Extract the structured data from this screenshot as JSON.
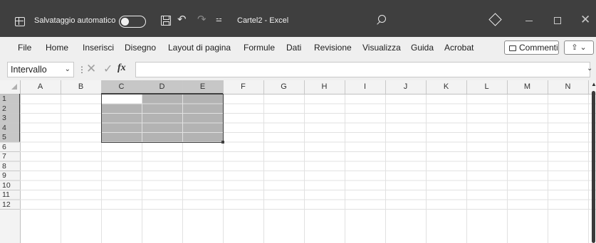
{
  "titlebar": {
    "autosave_label": "Salvataggio automatico",
    "filename": "Cartel2 - Excel",
    "undo_glyph": "↶",
    "redo_glyph": "↷",
    "qat_glyph": "⚍",
    "close_glyph": "✕",
    "icons": [
      "excel-icon",
      "autosave-toggle",
      "save-icon",
      "undo-icon",
      "redo-icon",
      "qat-customize-icon",
      "search-icon",
      "diamond-icon",
      "minimize-icon",
      "maximize-icon",
      "close-icon"
    ]
  },
  "menu": {
    "items": [
      "File",
      "Home",
      "Inserisci",
      "Disegno",
      "Layout di pagina",
      "Formule",
      "Dati",
      "Revisione",
      "Visualizza",
      "Guida",
      "Acrobat"
    ],
    "comments_label": "Commenti",
    "share_glyph": "⇪ ⌄"
  },
  "formula_bar": {
    "name_box": "Intervallo",
    "name_box_arrow": "⌄",
    "separator": "⋮",
    "cancel_glyph": "✕",
    "confirm_glyph": "✓",
    "fx_label": "fx",
    "expand_glyph": "⌄",
    "value": ""
  },
  "sheet": {
    "columns": [
      "A",
      "B",
      "C",
      "D",
      "E",
      "F",
      "G",
      "H",
      "I",
      "J",
      "K",
      "L",
      "M",
      "N"
    ],
    "rows": [
      "1",
      "2",
      "3",
      "4",
      "5",
      "6",
      "7",
      "8",
      "9",
      "10",
      "11",
      "12"
    ],
    "selection": "C1:E5",
    "active_cell": "C1",
    "colors": {
      "selection_fill": "#b3b3b3",
      "selected_header": "#c7c7c7",
      "header_bg": "#f3f3f3",
      "gridline": "#e1e1e1"
    }
  }
}
